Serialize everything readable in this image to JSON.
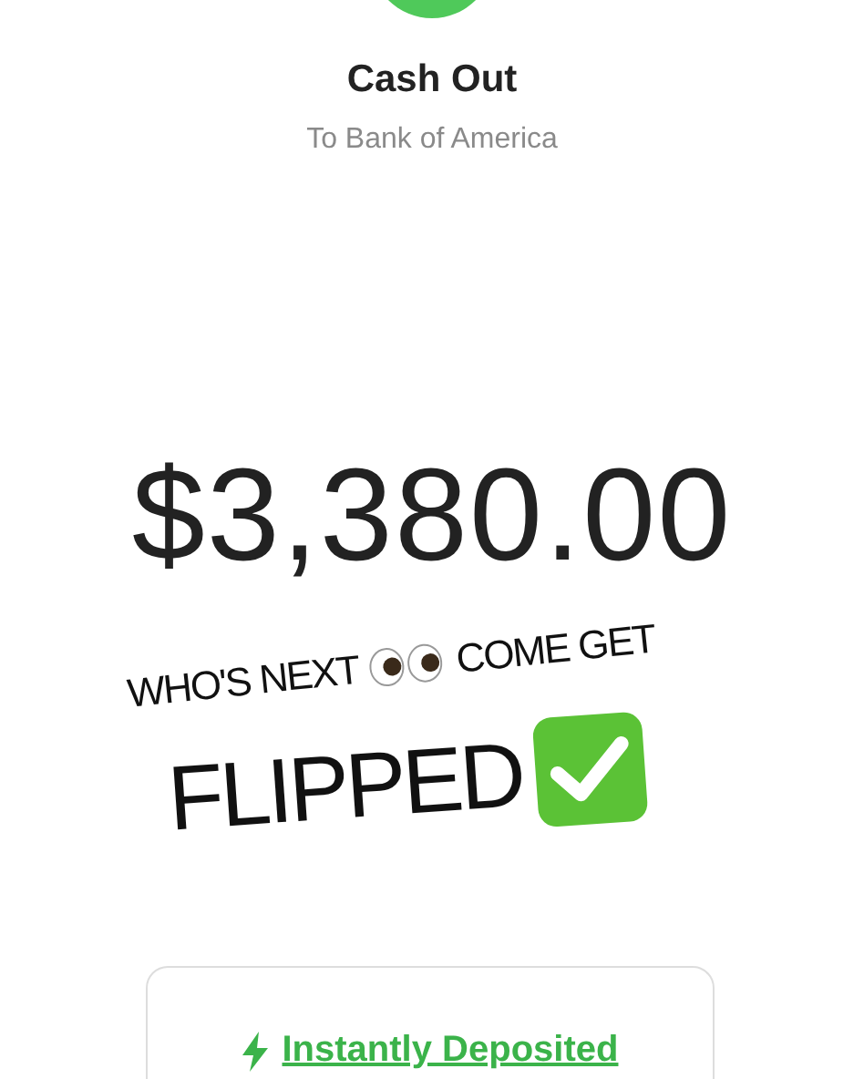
{
  "header": {
    "title": "Cash Out",
    "subtitle": "To Bank of America"
  },
  "amount": "$3,380.00",
  "overlay": {
    "line1_start": "WHO'S NEXT",
    "line1_end": "COME GET",
    "line2": "FLIPPED"
  },
  "status": {
    "label": "Instantly Deposited"
  }
}
